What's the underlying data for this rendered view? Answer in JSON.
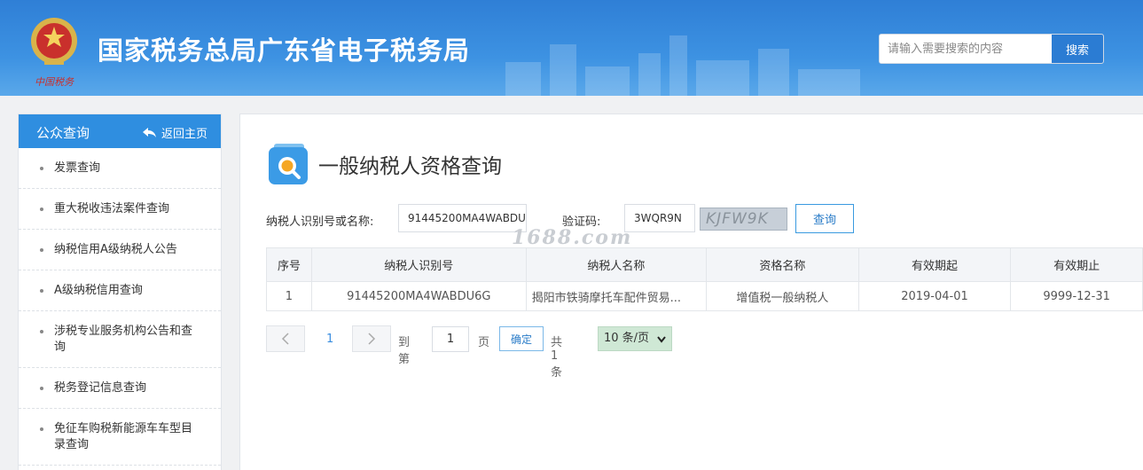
{
  "header": {
    "site_title": "国家税务总局广东省电子税务局",
    "search_placeholder": "请输入需要搜索的内容",
    "search_button": "搜索",
    "emblem_caption": "中国税务"
  },
  "sidebar": {
    "title": "公众查询",
    "back_label": "返回主页",
    "items": [
      {
        "label": "发票查询"
      },
      {
        "label": "重大税收违法案件查询"
      },
      {
        "label": "纳税信用A级纳税人公告"
      },
      {
        "label": "A级纳税信用查询"
      },
      {
        "label": "涉税专业服务机构公告和查询"
      },
      {
        "label": "税务登记信息查询"
      },
      {
        "label": "免征车购税新能源车车型目录查询"
      }
    ]
  },
  "main": {
    "page_title": "一般纳税人资格查询",
    "form": {
      "taxpayer_label": "纳税人识别号或名称:",
      "taxpayer_value": "91445200MA4WABDU6G",
      "captcha_label": "验证码:",
      "captcha_value": "3WQR9N",
      "captcha_image_text": "KJFW9K",
      "query_button": "查询"
    },
    "watermark": "1688.com",
    "table": {
      "headers": [
        "序号",
        "纳税人识别号",
        "纳税人名称",
        "资格名称",
        "有效期起",
        "有效期止"
      ],
      "rows": [
        [
          "1",
          "91445200MA4WABDU6G",
          "揭阳市铁骑摩托车配件贸易...",
          "增值税一般纳税人",
          "2019-04-01",
          "9999-12-31"
        ]
      ]
    },
    "pager": {
      "current_page": "1",
      "goto_label": "到第",
      "goto_value": "1",
      "page_unit": "页",
      "confirm_button": "确定",
      "total_text": "共 1 条",
      "page_size": "10 条/页"
    }
  },
  "colors": {
    "header_blue": "#3d92e2",
    "sidebar_head": "#2f8ee0",
    "button_blue": "#2b7cd3"
  }
}
